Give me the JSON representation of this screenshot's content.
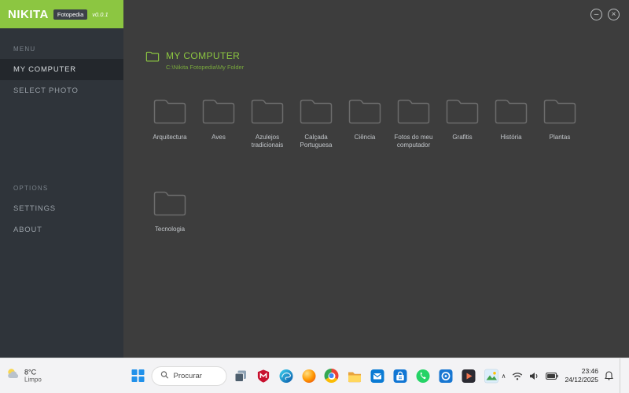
{
  "app": {
    "name": "NIKITA",
    "badge": "Fotopedia",
    "version": "v0.0.1"
  },
  "titlebar": {
    "minimize_glyph": "–",
    "close_glyph": "×"
  },
  "sidebar": {
    "menu_label": "MENU",
    "options_label": "OPTIONS",
    "items": [
      {
        "label": "MY COMPUTER",
        "active": true
      },
      {
        "label": "SELECT PHOTO",
        "active": false
      }
    ],
    "option_items": [
      {
        "label": "SETTINGS"
      },
      {
        "label": "ABOUT"
      }
    ]
  },
  "main": {
    "title": "MY COMPUTER",
    "path": "C:\\Nikita Fotopedia\\My Folder",
    "folders": [
      "Arquitectura",
      "Aves",
      "Azulejos tradicionais",
      "Calçada Portuguesa",
      "Ciência",
      "Fotos do meu computador",
      "Grafitis",
      "História",
      "Plantas",
      "Tecnologia"
    ]
  },
  "taskbar": {
    "weather": {
      "temperature": "8°C",
      "condition": "Limpo"
    },
    "search_placeholder": "Procurar",
    "apps": [
      "task-view",
      "mcafee",
      "edge",
      "firefox",
      "chrome",
      "file-explorer",
      "mail",
      "store",
      "whatsapp",
      "photos",
      "media-player",
      "pictures"
    ],
    "tray": {
      "time": "23:46",
      "date": "24/12/2025"
    }
  },
  "colors": {
    "accent_green": "#8cc641",
    "sidebar_bg": "#2f343a",
    "content_bg": "#3d3d3d",
    "taskbar_bg": "#f3f3f5"
  }
}
